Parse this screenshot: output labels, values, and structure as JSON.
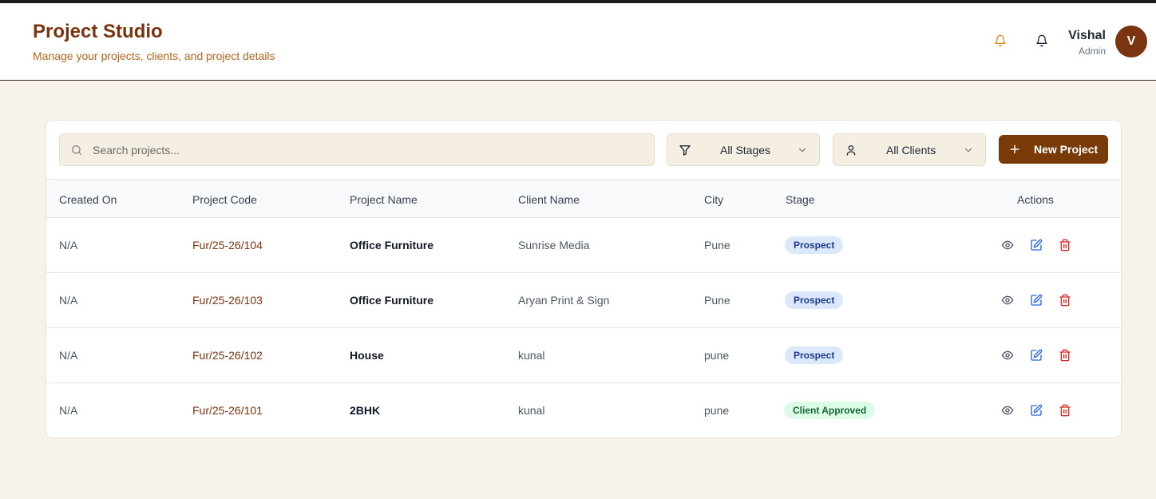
{
  "app": {
    "title": "Project Studio",
    "subtitle": "Manage your projects, clients, and project details"
  },
  "user": {
    "name": "Vishal",
    "role": "Admin",
    "initial": "V"
  },
  "colors": {
    "brand": "#7a3410",
    "button": "#7a3a08",
    "prospect_bg": "#dbe7fb",
    "approved_bg": "#dcfce7"
  },
  "toolbar": {
    "search_placeholder": "Search projects...",
    "stage_filter": "All Stages",
    "client_filter": "All Clients",
    "new_project_label": "New Project"
  },
  "table": {
    "headers": [
      "Created On",
      "Project Code",
      "Project Name",
      "Client Name",
      "City",
      "Stage",
      "Actions"
    ],
    "rows": [
      {
        "created": "N/A",
        "code": "Fur/25-26/104",
        "name": "Office Furniture",
        "client": "Sunrise Media",
        "city": "Pune",
        "stage": "Prospect"
      },
      {
        "created": "N/A",
        "code": "Fur/25-26/103",
        "name": "Office Furniture",
        "client": "Aryan Print & Sign",
        "city": "Pune",
        "stage": "Prospect"
      },
      {
        "created": "N/A",
        "code": "Fur/25-26/102",
        "name": "House",
        "client": "kunal",
        "city": "pune",
        "stage": "Prospect"
      },
      {
        "created": "N/A",
        "code": "Fur/25-26/101",
        "name": "2BHK",
        "client": "kunal",
        "city": "pune",
        "stage": "Client Approved"
      }
    ]
  },
  "icons": [
    "bell-orange-icon",
    "bell-icon",
    "search-icon",
    "filter-icon",
    "user-icon",
    "chevron-down-icon",
    "plus-icon",
    "eye-icon",
    "edit-icon",
    "trash-icon"
  ]
}
